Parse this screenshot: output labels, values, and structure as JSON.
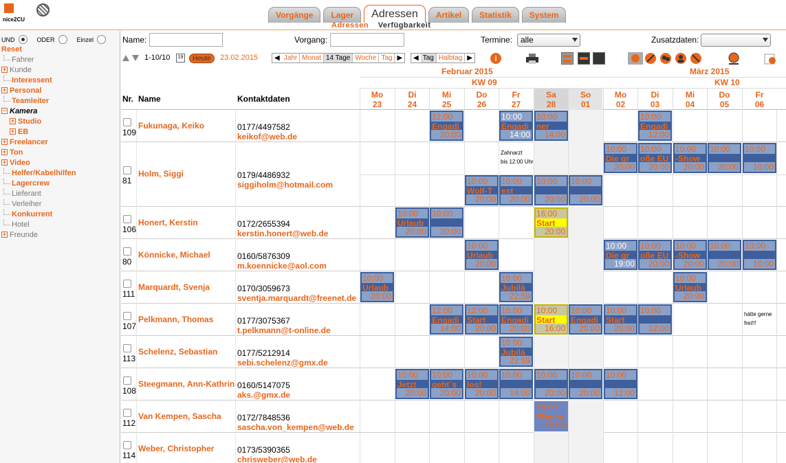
{
  "app": {
    "logo_text": "nice2CU"
  },
  "tabs": [
    {
      "label": "Vorgänge"
    },
    {
      "label": "Lager"
    },
    {
      "label": "Adressen"
    },
    {
      "label": "Artikel"
    },
    {
      "label": "Statistik"
    },
    {
      "label": "System"
    }
  ],
  "subtabs": {
    "active": "Adressen",
    "other": "Verfügbarkeit"
  },
  "sidebar": {
    "logic": {
      "und": "UND",
      "oder": "ODER",
      "einzel": "Einzel"
    },
    "items": [
      {
        "label": "Reset",
        "style": "o",
        "kind": "none"
      },
      {
        "label": "Fahrer",
        "style": "g",
        "kind": "conn"
      },
      {
        "label": "Kunde",
        "style": "g",
        "kind": "plus"
      },
      {
        "label": "Interessent",
        "style": "o",
        "kind": "conn"
      },
      {
        "label": "Personal",
        "style": "o",
        "kind": "plus"
      },
      {
        "label": "Teamleiter",
        "style": "o",
        "kind": "conn"
      },
      {
        "label": "Kamera",
        "style": "k",
        "kind": "minus"
      },
      {
        "label": "Studio",
        "style": "o",
        "kind": "plus2"
      },
      {
        "label": "EB",
        "style": "o",
        "kind": "plus2"
      },
      {
        "label": "Freelancer",
        "style": "o",
        "kind": "plus"
      },
      {
        "label": "Ton",
        "style": "o",
        "kind": "plus"
      },
      {
        "label": "Video",
        "style": "o",
        "kind": "plus"
      },
      {
        "label": "Helfer/Kabelhilfen",
        "style": "o",
        "kind": "conn"
      },
      {
        "label": "Lagercrew",
        "style": "o",
        "kind": "conn"
      },
      {
        "label": "Lieferant",
        "style": "g",
        "kind": "conn"
      },
      {
        "label": "Verleiher",
        "style": "g",
        "kind": "conn"
      },
      {
        "label": "Konkurrent",
        "style": "o",
        "kind": "conn"
      },
      {
        "label": "Hotel",
        "style": "g",
        "kind": "conn"
      },
      {
        "label": "Freunde",
        "style": "g",
        "kind": "plus"
      }
    ]
  },
  "filter": {
    "name_label": "Name:",
    "name_value": "",
    "vorgang_label": "Vorgang:",
    "vorgang_value": "",
    "termine_label": "Termine:",
    "termine_value": "alle",
    "zusatz_label": "Zusatzdaten:",
    "zusatz_value": ""
  },
  "toolbar": {
    "range": "1-10/10",
    "cal_day": "19",
    "heute": "Heute",
    "date": "23.02.2015",
    "views": [
      "Jahr",
      "Monat",
      "14 Tage",
      "Woche",
      "Tag"
    ],
    "active_view": "14 Tage",
    "views2": [
      "Tag",
      "Halbtag"
    ],
    "active_view2": "Tag"
  },
  "table": {
    "col_nr": "Nr.",
    "col_name": "Name",
    "col_kontakt": "Kontaktdaten",
    "months": [
      {
        "label": "Februar 2015"
      },
      {
        "label": "März 2015"
      }
    ],
    "kws": [
      {
        "label": "KW 09"
      },
      {
        "label": "KW 10"
      }
    ],
    "days": [
      {
        "dow": "Mo",
        "d": "23",
        "t": ""
      },
      {
        "dow": "Di",
        "d": "24",
        "t": ""
      },
      {
        "dow": "Mi",
        "d": "25",
        "t": ""
      },
      {
        "dow": "Do",
        "d": "26",
        "t": ""
      },
      {
        "dow": "Fr",
        "d": "27",
        "t": ""
      },
      {
        "dow": "Sa",
        "d": "28",
        "t": "we"
      },
      {
        "dow": "So",
        "d": "01",
        "t": "so"
      },
      {
        "dow": "Mo",
        "d": "02",
        "t": ""
      },
      {
        "dow": "Di",
        "d": "03",
        "t": ""
      },
      {
        "dow": "Mi",
        "d": "04",
        "t": ""
      },
      {
        "dow": "Do",
        "d": "05",
        "t": ""
      },
      {
        "dow": "Fr",
        "d": "06",
        "t": ""
      }
    ],
    "rows": [
      {
        "nr": "109",
        "name": "Fukunaga, Keiko",
        "phone": "0177/4497582",
        "email": "keikof@web.de",
        "h": 47,
        "events": [
          {
            "day": 2,
            "sub": 0,
            "t1": "12:00",
            "lb": "Engadi",
            "t2": "20:00"
          },
          {
            "day": 4,
            "sub": 0,
            "t1": "10:00",
            "lb": "Engadi",
            "t2": "14:00",
            "w": true
          },
          {
            "day": 5,
            "sub": 0,
            "t1": "10:00",
            "lb": "ner",
            "t2": "14:00"
          },
          {
            "day": 8,
            "sub": 0,
            "t1": "10:00",
            "lb": "Engadi",
            "t2": "12:00"
          }
        ]
      },
      {
        "nr": "81",
        "name": "Holm, Siggi",
        "phone": "0179/4486932",
        "email": "siggiholm@hotmail.com",
        "h": 94,
        "notes": [
          {
            "day": 4,
            "sub": 0,
            "text1": "Zahnarzt",
            "text2": "bis 12:00 Uhr"
          }
        ],
        "events": [
          {
            "day": 7,
            "sub": 0,
            "t1": "10:00",
            "lb": "Die gr",
            "t2": "20:00"
          },
          {
            "day": 8,
            "sub": 0,
            "t1": "10:00",
            "lb": "oße EU",
            "t2": "20:00"
          },
          {
            "day": 9,
            "sub": 0,
            "t1": "10:00",
            "lb": "-Show",
            "t2": "20:00"
          },
          {
            "day": 10,
            "sub": 0,
            "t1": "10:00",
            "lb": "",
            "t2": "20:00"
          },
          {
            "day": 11,
            "sub": 0,
            "t1": "10:00",
            "lb": "",
            "t2": "10:00"
          },
          {
            "day": 3,
            "sub": 1,
            "t1": "10:00",
            "lb": "Wolf-T",
            "t2": "20:00"
          },
          {
            "day": 4,
            "sub": 1,
            "t1": "10:00",
            "lb": "est",
            "t2": "20:00"
          },
          {
            "day": 5,
            "sub": 1,
            "t1": "10:00",
            "lb": "",
            "t2": "20:00"
          },
          {
            "day": 6,
            "sub": 1,
            "t1": "10:00",
            "lb": "",
            "t2": "20:00"
          }
        ]
      },
      {
        "nr": "106",
        "name": "Honert, Kerstin",
        "phone": "0172/2655394",
        "email": "kerstin.honert@web.de",
        "h": 47,
        "events": [
          {
            "day": 1,
            "sub": 0,
            "t1": "10:00",
            "lb": "Urlaub",
            "t2": "20:00"
          },
          {
            "day": 2,
            "sub": 0,
            "t1": "10:00",
            "lb": "",
            "t2": "20:00"
          },
          {
            "day": 5,
            "sub": 0,
            "t1": "16:00",
            "lb": "Start",
            "t2": "20:00",
            "y": true
          }
        ]
      },
      {
        "nr": "80",
        "name": "Könnicke, Michael",
        "phone": "0160/5876309",
        "email": "m.koennicke@aol.com",
        "h": 47,
        "events": [
          {
            "day": 3,
            "sub": 0,
            "t1": "10:00",
            "lb": "Urlaub",
            "t2": "20:00"
          },
          {
            "day": 7,
            "sub": 0,
            "t1": "10:00",
            "lb": "Die gr",
            "t2": "19:00",
            "w": true
          },
          {
            "day": 8,
            "sub": 0,
            "t1": "10:00",
            "lb": "oße EU",
            "t2": "20:00"
          },
          {
            "day": 9,
            "sub": 0,
            "t1": "10:00",
            "lb": "-Show",
            "t2": "20:00"
          },
          {
            "day": 10,
            "sub": 0,
            "t1": "10:00",
            "lb": "",
            "t2": "20:00"
          },
          {
            "day": 11,
            "sub": 0,
            "t1": "10:00",
            "lb": "",
            "t2": "10:00"
          }
        ]
      },
      {
        "nr": "111",
        "name": "Marquardt, Svenja",
        "phone": "0170/3059673",
        "email": "sventja.marquardt@freenet.de",
        "h": 47,
        "events": [
          {
            "day": 0,
            "sub": 0,
            "t1": "10:00",
            "lb": "Urlaub",
            "t2": "20:00"
          },
          {
            "day": 4,
            "sub": 0,
            "t1": "10:00",
            "lb": "Jubilä",
            "t2": "22:59"
          },
          {
            "day": 9,
            "sub": 0,
            "t1": "10:00",
            "lb": "Urlaub",
            "t2": "20:00"
          }
        ]
      },
      {
        "nr": "107",
        "name": "Pelkmann, Thomas",
        "phone": "0177/3075367",
        "email": "t.pelkmann@t-online.de",
        "h": 47,
        "notes": [
          {
            "day": 11,
            "sub": 0,
            "text1": "hätte gerne",
            "text2": "frei!!!"
          }
        ],
        "events": [
          {
            "day": 2,
            "sub": 0,
            "t1": "12:00",
            "lb": "Engadi",
            "t2": "14:00"
          },
          {
            "day": 3,
            "sub": 0,
            "t1": "12:00",
            "lb": "Start",
            "t2": "20:00"
          },
          {
            "day": 4,
            "sub": 0,
            "t1": "10:00",
            "lb": "Engadi",
            "t2": "20:00"
          },
          {
            "day": 5,
            "sub": 0,
            "t1": "10:00",
            "lb": "Start",
            "t2": "16:00",
            "y": true
          },
          {
            "day": 6,
            "sub": 0,
            "t1": "10:00",
            "lb": "Engadi",
            "t2": "20:00"
          },
          {
            "day": 7,
            "sub": 0,
            "t1": "10:00",
            "lb": "Start",
            "t2": "20:00"
          },
          {
            "day": 8,
            "sub": 0,
            "t1": "10:00",
            "lb": "",
            "t2": "12:00"
          }
        ]
      },
      {
        "nr": "113",
        "name": "Schelenz, Sebastian",
        "phone": "0177/5212914",
        "email": "sebi.schelenz@gmx.de",
        "h": 47,
        "events": [
          {
            "day": 4,
            "sub": 0,
            "t1": "10:00",
            "lb": "Jubilä",
            "t2": "22:59"
          }
        ]
      },
      {
        "nr": "108",
        "name": "Steegmann, Ann-Kathrin",
        "phone": "0160/5147075",
        "email": "aks.@gmx.de",
        "h": 47,
        "events": [
          {
            "day": 1,
            "sub": 0,
            "t1": "10:00",
            "lb": "Jetzt",
            "t2": "20:00"
          },
          {
            "day": 2,
            "sub": 0,
            "t1": "10:00",
            "lb": "geht´s",
            "t2": "20:00"
          },
          {
            "day": 3,
            "sub": 0,
            "t1": "10:00",
            "lb": "los!",
            "t2": "20:00"
          },
          {
            "day": 4,
            "sub": 0,
            "t1": "10:00",
            "lb": "",
            "t2": "14:00"
          },
          {
            "day": 5,
            "sub": 0,
            "t1": "10:00",
            "lb": "",
            "t2": "20:00"
          },
          {
            "day": 6,
            "sub": 0,
            "t1": "10:00",
            "lb": "",
            "t2": "20:00"
          },
          {
            "day": 7,
            "sub": 0,
            "t1": "10:00",
            "lb": "",
            "t2": "12:00"
          }
        ]
      },
      {
        "nr": "112",
        "name": "Van Kempen, Sascha",
        "phone": "0172/7848536",
        "email": "sascha.von_kempen@web.de",
        "h": 47,
        "events": [
          {
            "day": 5,
            "sub": 0,
            "t1": "18:00 ??",
            "lb": "Presse",
            "t2": "18:00 ??",
            "lt": true
          }
        ]
      },
      {
        "nr": "114",
        "name": "Weber, Christopher",
        "phone": "0173/5390365",
        "email": "chrisweber@web.de",
        "h": 47,
        "events": []
      }
    ]
  },
  "colors": {
    "accent": "#e8661c",
    "event": "#3e5f9c",
    "event_time": "#8aa1c8",
    "highlight": "#ffff00"
  }
}
